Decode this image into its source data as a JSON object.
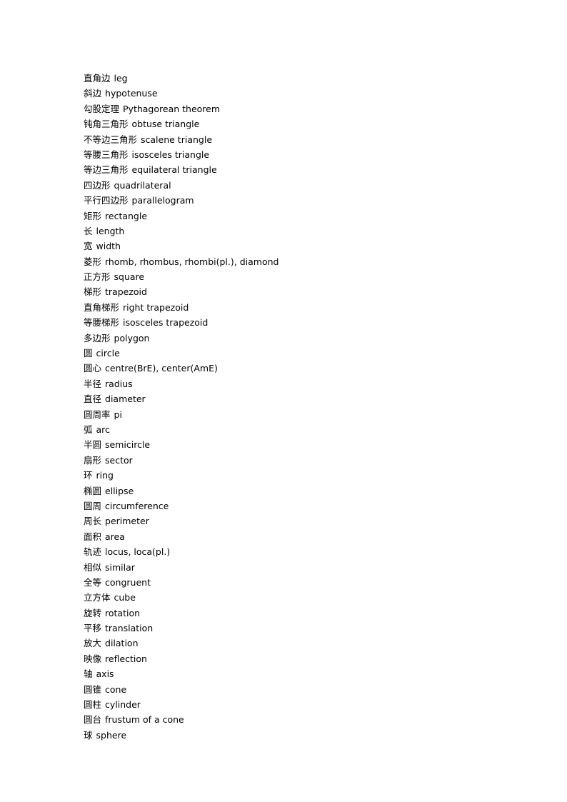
{
  "document": {
    "background_color": "#ffffff",
    "text_color": "#000000",
    "entries": [
      {
        "zh": "直角边",
        "en": "leg"
      },
      {
        "zh": "斜边",
        "en": "hypotenuse"
      },
      {
        "zh": "勾股定理",
        "en": "Pythagorean theorem"
      },
      {
        "zh": "钝角三角形",
        "en": "obtuse triangle"
      },
      {
        "zh": "不等边三角形",
        "en": "scalene triangle"
      },
      {
        "zh": "等腰三角形",
        "en": "isosceles triangle"
      },
      {
        "zh": "等边三角形",
        "en": "equilateral triangle"
      },
      {
        "zh": "四边形",
        "en": "quadrilateral"
      },
      {
        "zh": "平行四边形",
        "en": "parallelogram"
      },
      {
        "zh": "矩形",
        "en": "rectangle"
      },
      {
        "zh": "长",
        "en": "length"
      },
      {
        "zh": "宽",
        "en": "width"
      },
      {
        "zh": "菱形",
        "en": "rhomb, rhombus, rhombi(pl.), diamond"
      },
      {
        "zh": "正方形",
        "en": "square"
      },
      {
        "zh": "梯形",
        "en": "trapezoid"
      },
      {
        "zh": "直角梯形",
        "en": "right trapezoid"
      },
      {
        "zh": "等腰梯形",
        "en": "isosceles trapezoid"
      },
      {
        "zh": "多边形",
        "en": "polygon"
      },
      {
        "zh": "圆",
        "en": "circle"
      },
      {
        "zh": "圆心",
        "en": "centre(BrE), center(AmE)"
      },
      {
        "zh": "半径",
        "en": "radius"
      },
      {
        "zh": "直径",
        "en": "diameter"
      },
      {
        "zh": "圆周率",
        "en": "pi"
      },
      {
        "zh": "弧",
        "en": "arc"
      },
      {
        "zh": "半圆",
        "en": "semicircle"
      },
      {
        "zh": "扇形",
        "en": "sector"
      },
      {
        "zh": "环",
        "en": "ring"
      },
      {
        "zh": "椭圆",
        "en": "ellipse"
      },
      {
        "zh": "圆周",
        "en": "circumference"
      },
      {
        "zh": "周长",
        "en": "perimeter"
      },
      {
        "zh": "面积",
        "en": "area"
      },
      {
        "zh": "轨迹",
        "en": "locus, loca(pl.)"
      },
      {
        "zh": "相似",
        "en": "similar"
      },
      {
        "zh": "全等",
        "en": "congruent"
      },
      {
        "zh": "立方体",
        "en": "cube"
      },
      {
        "zh": "旋转",
        "en": "rotation"
      },
      {
        "zh": "平移",
        "en": "translation"
      },
      {
        "zh": "放大",
        "en": "dilation"
      },
      {
        "zh": "映像",
        "en": "reflection"
      },
      {
        "zh": "轴",
        "en": "axis"
      },
      {
        "zh": "圆锥",
        "en": "cone"
      },
      {
        "zh": "圆柱",
        "en": "cylinder"
      },
      {
        "zh": "圆台",
        "en": "frustum of a cone"
      },
      {
        "zh": "球",
        "en": "sphere"
      }
    ]
  }
}
